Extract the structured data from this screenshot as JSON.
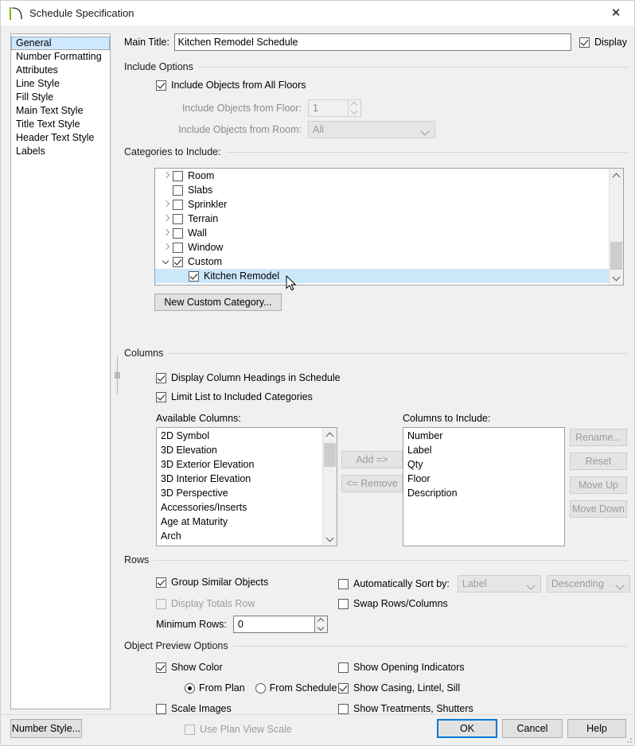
{
  "window": {
    "title": "Schedule Specification",
    "icon": "arc-icon",
    "close_label": "✕"
  },
  "sidebar": {
    "items": [
      {
        "label": "General",
        "selected": true
      },
      {
        "label": "Number Formatting",
        "selected": false
      },
      {
        "label": "Attributes",
        "selected": false
      },
      {
        "label": "Line Style",
        "selected": false
      },
      {
        "label": "Fill Style",
        "selected": false
      },
      {
        "label": "Main Text Style",
        "selected": false
      },
      {
        "label": "Title Text Style",
        "selected": false
      },
      {
        "label": "Header Text Style",
        "selected": false
      },
      {
        "label": "Labels",
        "selected": false
      }
    ]
  },
  "main_title": {
    "label": "Main Title:",
    "value": "Kitchen Remodel Schedule",
    "display_label": "Display",
    "display_checked": true
  },
  "include_options": {
    "group_label": "Include Options",
    "all_floors_label": "Include Objects from All Floors",
    "all_floors_checked": true,
    "floor_label": "Include Objects from Floor:",
    "floor_value": "1",
    "floor_disabled": true,
    "room_label": "Include Objects from Room:",
    "room_value": "All",
    "room_disabled": true
  },
  "categories": {
    "group_label": "Categories to Include:",
    "rows": [
      {
        "label": "Room",
        "expander": "right",
        "checked": false,
        "indent": 0,
        "selected": false
      },
      {
        "label": "Slabs",
        "expander": "none",
        "checked": false,
        "indent": 0,
        "selected": false
      },
      {
        "label": "Sprinkler",
        "expander": "right",
        "checked": false,
        "indent": 0,
        "selected": false
      },
      {
        "label": "Terrain",
        "expander": "right",
        "checked": false,
        "indent": 0,
        "selected": false
      },
      {
        "label": "Wall",
        "expander": "right",
        "checked": false,
        "indent": 0,
        "selected": false
      },
      {
        "label": "Window",
        "expander": "right",
        "checked": false,
        "indent": 0,
        "selected": false
      },
      {
        "label": "Custom",
        "expander": "down",
        "checked": true,
        "indent": 0,
        "selected": false
      },
      {
        "label": "Kitchen Remodel",
        "expander": "none",
        "checked": true,
        "indent": 1,
        "selected": true
      }
    ],
    "new_category_button": "New Custom Category..."
  },
  "columns": {
    "group_label": "Columns",
    "display_headings_label": "Display Column Headings in Schedule",
    "display_headings_checked": true,
    "limit_list_label": "Limit List to Included Categories",
    "limit_list_checked": true,
    "available_label": "Available Columns:",
    "available_items": [
      "2D Symbol",
      "3D Elevation",
      "3D Exterior Elevation",
      "3D Interior Elevation",
      "3D Perspective",
      "Accessories/Inserts",
      "Age at Maturity",
      "Arch"
    ],
    "include_label": "Columns to Include:",
    "include_items": [
      "Number",
      "Label",
      "Qty",
      "Floor",
      "Description"
    ],
    "add_button": "Add =>",
    "remove_button": "<= Remove",
    "rename_button": "Rename...",
    "reset_button": "Reset",
    "move_up_button": "Move Up",
    "move_down_button": "Move Down"
  },
  "rows": {
    "group_label": "Rows",
    "group_similar_label": "Group Similar Objects",
    "group_similar_checked": true,
    "display_totals_label": "Display Totals Row",
    "display_totals_checked": false,
    "display_totals_disabled": true,
    "minimum_rows_label": "Minimum Rows:",
    "minimum_rows_value": "0",
    "auto_sort_label": "Automatically Sort by:",
    "auto_sort_checked": false,
    "sort_field": "Label",
    "sort_order": "Descending",
    "swap_label": "Swap Rows/Columns",
    "swap_checked": false
  },
  "preview": {
    "group_label": "Object Preview Options",
    "show_color_label": "Show Color",
    "show_color_checked": true,
    "from_plan_label": "From Plan",
    "from_schedule_label": "From Schedule",
    "color_source": "From Plan",
    "scale_images_label": "Scale Images",
    "scale_images_checked": false,
    "use_plan_view_scale_label": "Use Plan View Scale",
    "use_plan_view_scale_checked": false,
    "use_plan_view_scale_disabled": true,
    "show_opening_label": "Show Opening Indicators",
    "show_opening_checked": false,
    "show_casing_label": "Show Casing, Lintel, Sill",
    "show_casing_checked": true,
    "show_treatments_label": "Show Treatments, Shutters",
    "show_treatments_checked": false
  },
  "footer": {
    "number_style_button": "Number Style...",
    "ok_button": "OK",
    "cancel_button": "Cancel",
    "help_button": "Help"
  },
  "colors": {
    "accent": "#0078d7",
    "selection": "#cbe8fb",
    "dialog_bg": "#f0f0f0",
    "brand_green": "#7ab800"
  }
}
